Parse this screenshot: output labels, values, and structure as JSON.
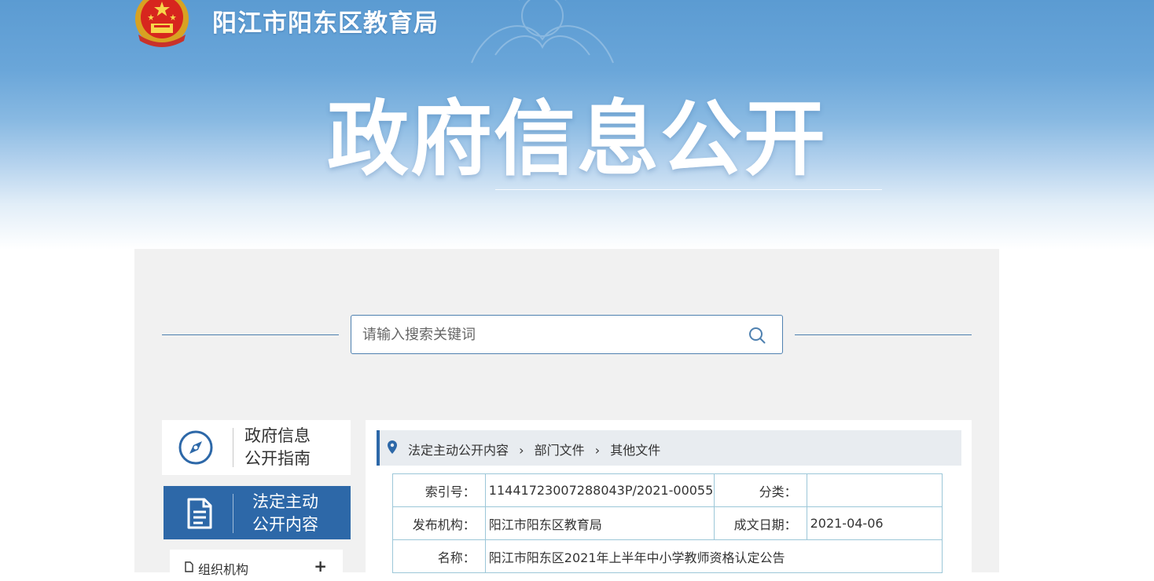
{
  "header": {
    "site_name": "阳江市阳东区教育局",
    "hero_title": "政府信息公开",
    "emblem_icon": "national-emblem"
  },
  "search": {
    "placeholder": "请输入搜索关键词",
    "icon": "search-icon"
  },
  "sidebar": {
    "guide": {
      "label_line1": "政府信息",
      "label_line2": "公开指南",
      "icon": "compass-icon"
    },
    "active": {
      "label_line1": "法定主动",
      "label_line2": "公开内容",
      "icon": "document-icon"
    },
    "items": [
      {
        "label": "组织机构",
        "expand": "+"
      }
    ]
  },
  "breadcrumb": {
    "items": [
      "法定主动公开内容",
      "部门文件",
      "其他文件"
    ],
    "icon": "location-pin-icon"
  },
  "meta_table": {
    "index_label": "索引号：",
    "index_value": "11441723007288043P/2021-00055",
    "category_label": "分类：",
    "category_value": "",
    "publisher_label": "发布机构：",
    "publisher_value": "阳江市阳东区教育局",
    "date_label": "成文日期：",
    "date_value": "2021-04-06",
    "name_label": "名称：",
    "name_value": "阳江市阳东区2021年上半年中小学教师资格认定公告"
  },
  "colors": {
    "accent": "#2d68a8",
    "panel_bg": "#f1f1f1",
    "table_border": "#9cc7d8"
  }
}
